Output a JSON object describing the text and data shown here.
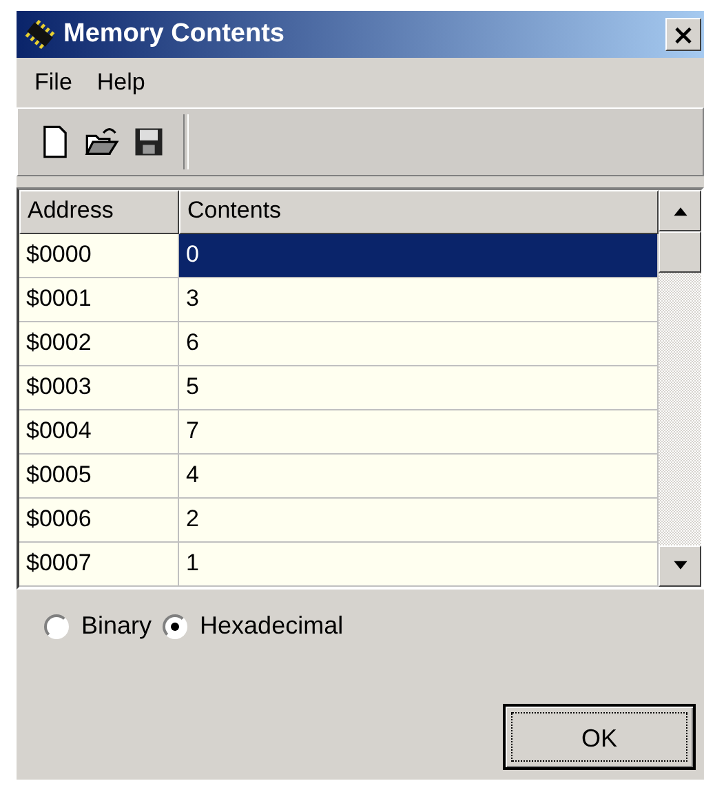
{
  "window": {
    "title": "Memory Contents",
    "close": "×"
  },
  "menu": [
    {
      "label": "File"
    },
    {
      "label": "Help"
    }
  ],
  "toolbar": [
    {
      "kind": "new"
    },
    {
      "kind": "open"
    },
    {
      "kind": "save"
    }
  ],
  "table": {
    "columns": [
      "Address",
      "Contents"
    ],
    "rows": [
      {
        "address": "$0000",
        "contents": "0",
        "selected": true
      },
      {
        "address": "$0001",
        "contents": "3",
        "selected": false
      },
      {
        "address": "$0002",
        "contents": "6",
        "selected": false
      },
      {
        "address": "$0003",
        "contents": "5",
        "selected": false
      },
      {
        "address": "$0004",
        "contents": "7",
        "selected": false
      },
      {
        "address": "$0005",
        "contents": "4",
        "selected": false
      },
      {
        "address": "$0006",
        "contents": "2",
        "selected": false
      },
      {
        "address": "$0007",
        "contents": "1",
        "selected": false
      }
    ]
  },
  "format": [
    {
      "label": "Binary",
      "selected": false
    },
    {
      "label": "Hexadecimal",
      "selected": true
    }
  ],
  "buttons": [
    "OK"
  ]
}
